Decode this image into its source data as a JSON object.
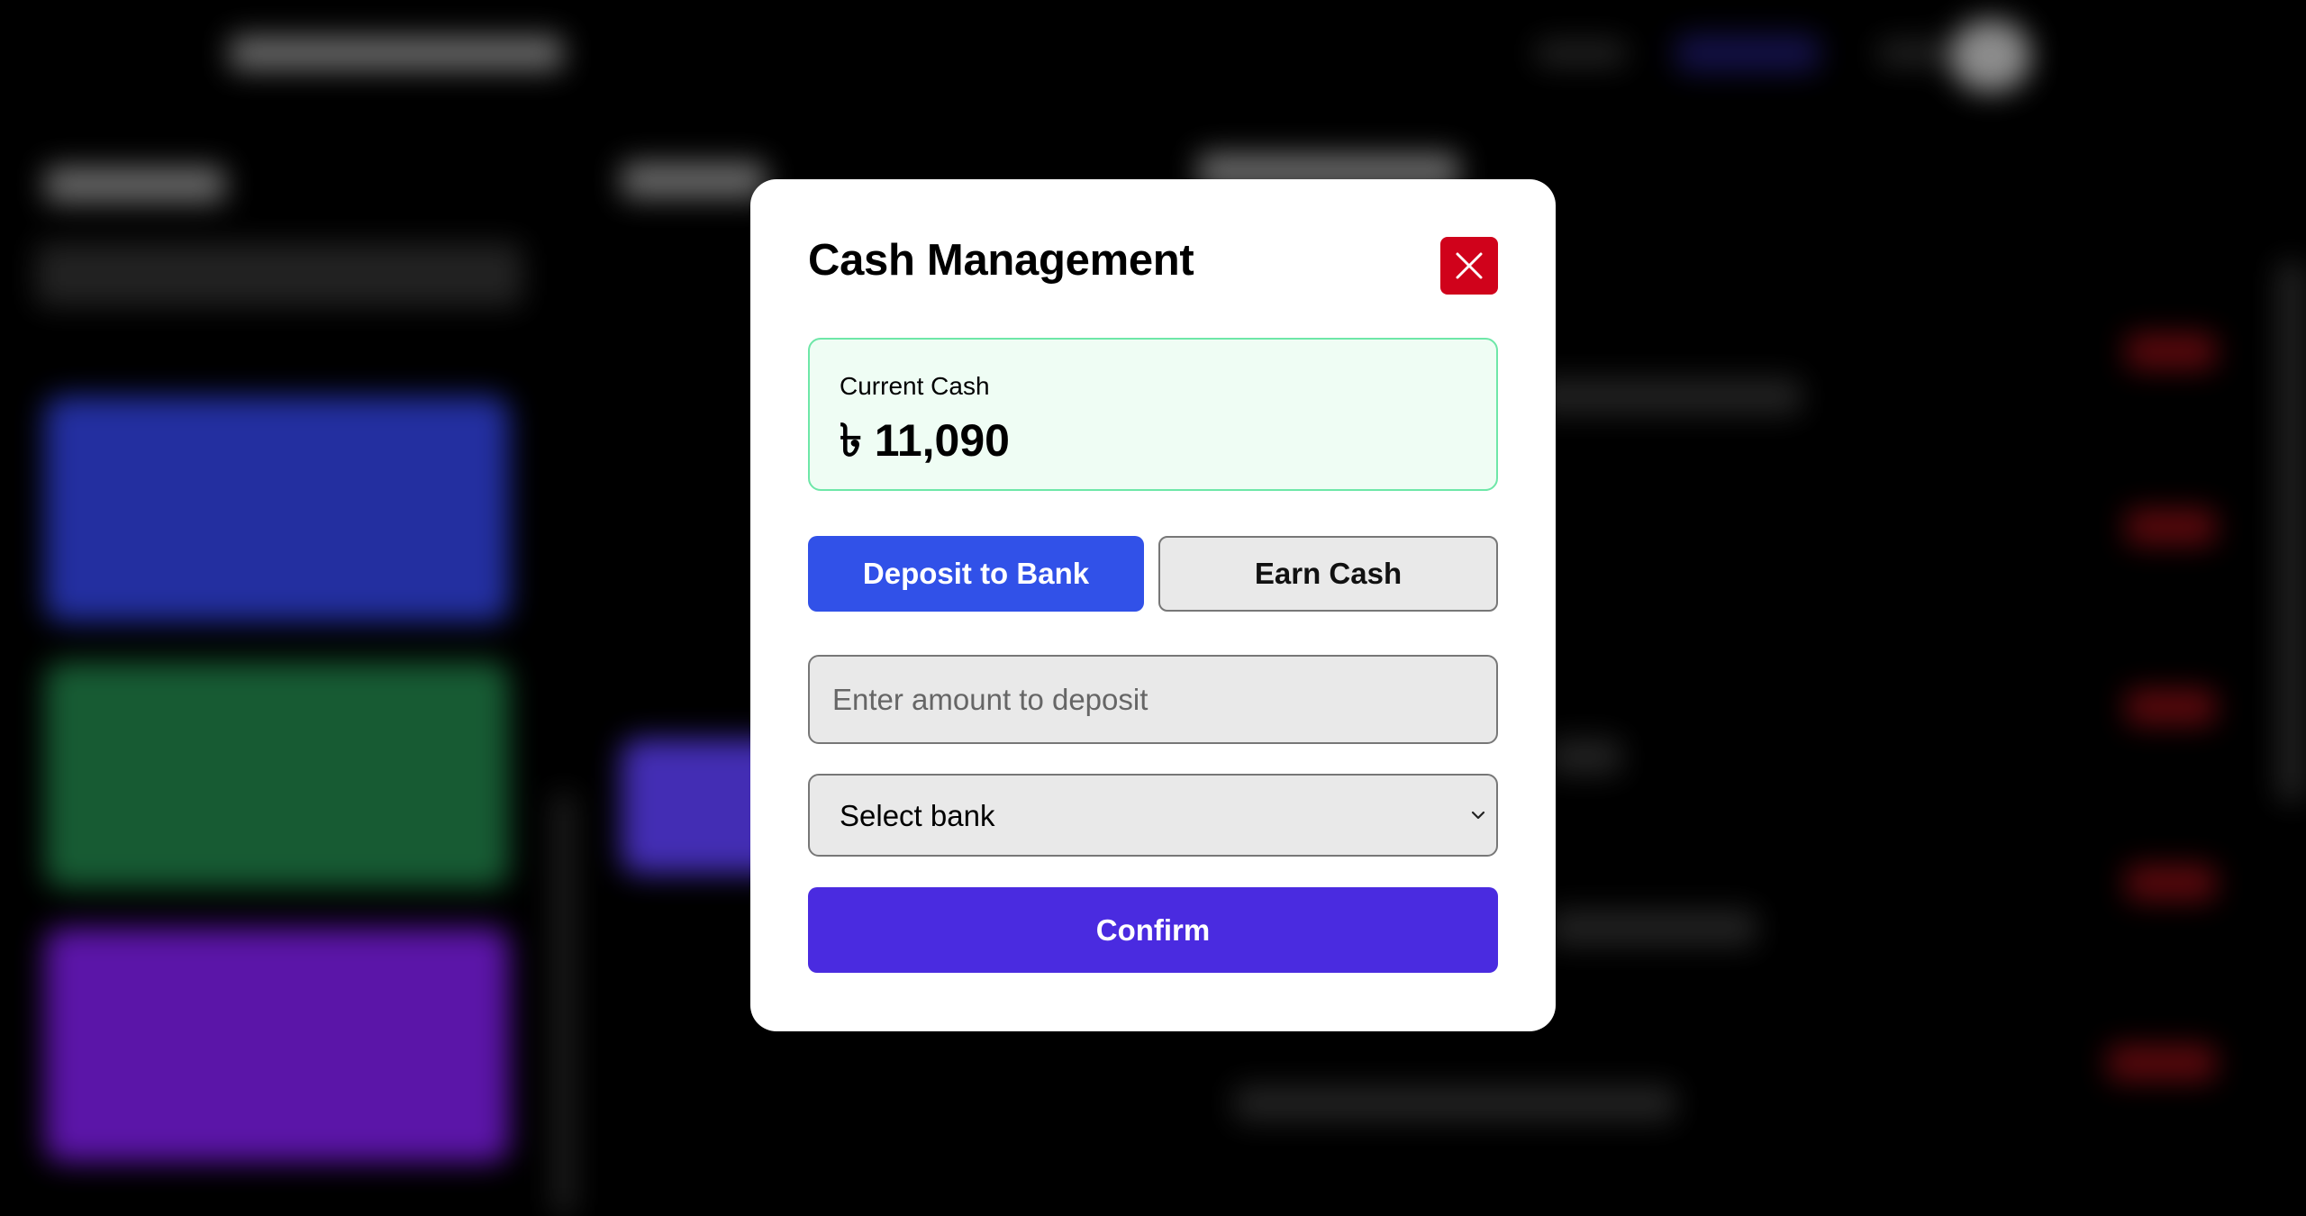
{
  "modal": {
    "title": "Cash Management",
    "close_icon": "close-x-icon",
    "current_cash": {
      "label": "Current Cash",
      "value": "৳ 11,090",
      "accent_color": "#6ee7a8"
    },
    "tabs": [
      {
        "label": "Deposit to Bank",
        "active": true
      },
      {
        "label": "Earn Cash",
        "active": false
      }
    ],
    "amount_input": {
      "value": "",
      "placeholder": "Enter amount to deposit"
    },
    "bank_select": {
      "selected": "Select bank",
      "icon": "chevron-down-icon"
    },
    "confirm_label": "Confirm"
  },
  "colors": {
    "close_button": "#d0021b",
    "deposit_tab": "#3151e8",
    "confirm_button": "#4a2be0"
  }
}
